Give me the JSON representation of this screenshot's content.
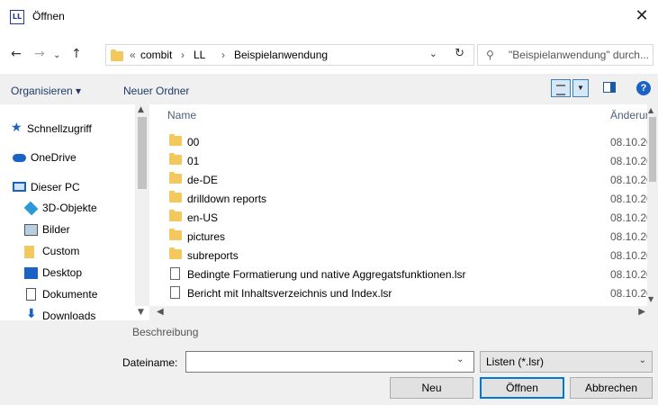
{
  "window": {
    "icon_text": "LL",
    "title": "Öffnen",
    "close_glyph": "✕"
  },
  "nav": {
    "back_glyph": "←",
    "forward_glyph": "→",
    "recent_glyph": "⌄",
    "up_glyph": "↑"
  },
  "address": {
    "overflow": "«",
    "segments": [
      "combit",
      "LL",
      "Beispielanwendung"
    ],
    "separator": "›",
    "dropdown_glyph": "⌄",
    "refresh_glyph": "↻"
  },
  "search": {
    "icon_glyph": "⚲",
    "placeholder": "\"Beispielanwendung\" durch..."
  },
  "toolbar": {
    "organize": "Organisieren ▾",
    "new_folder": "Neuer Ordner",
    "view_dropdown_glyph": "▼",
    "help": "?"
  },
  "sidebar": {
    "items": [
      {
        "label": "Schnellzugriff",
        "icon": "star-icon"
      },
      {
        "label": "OneDrive",
        "icon": "cloud-icon"
      },
      {
        "label": "Dieser PC",
        "icon": "computer-icon"
      },
      {
        "label": "3D-Objekte",
        "icon": "cube-icon"
      },
      {
        "label": "Bilder",
        "icon": "pictures-icon"
      },
      {
        "label": "Custom",
        "icon": "folder-icon"
      },
      {
        "label": "Desktop",
        "icon": "desktop-icon"
      },
      {
        "label": "Dokumente",
        "icon": "documents-icon"
      },
      {
        "label": "Downloads",
        "icon": "downloads-icon"
      }
    ]
  },
  "filelist": {
    "columns": {
      "name": "Name",
      "date": "Änderur"
    },
    "sort_glyph": "^",
    "rows": [
      {
        "name": "00",
        "date": "08.10.20",
        "kind": "folder"
      },
      {
        "name": "01",
        "date": "08.10.20",
        "kind": "folder"
      },
      {
        "name": "de-DE",
        "date": "08.10.20",
        "kind": "folder"
      },
      {
        "name": "drilldown reports",
        "date": "08.10.20",
        "kind": "folder"
      },
      {
        "name": "en-US",
        "date": "08.10.20",
        "kind": "folder"
      },
      {
        "name": "pictures",
        "date": "08.10.20",
        "kind": "folder"
      },
      {
        "name": "subreports",
        "date": "08.10.20",
        "kind": "folder"
      },
      {
        "name": "Bedingte Formatierung und native Aggregatsfunktionen.lsr",
        "date": "08.10.20",
        "kind": "file"
      },
      {
        "name": "Bericht mit Inhaltsverzeichnis und Index.lsr",
        "date": "08.10.20",
        "kind": "file"
      }
    ]
  },
  "bottom": {
    "description_label": "Beschreibung",
    "filename_label": "Dateiname:",
    "filename_value": "",
    "filetype_value": "Listen (*.lsr)",
    "buttons": {
      "new": "Neu",
      "open": "Öffnen",
      "cancel": "Abbrechen"
    }
  },
  "colors": {
    "accent": "#0078d7",
    "folder": "#f3c85c",
    "link": "#1f3a68"
  }
}
